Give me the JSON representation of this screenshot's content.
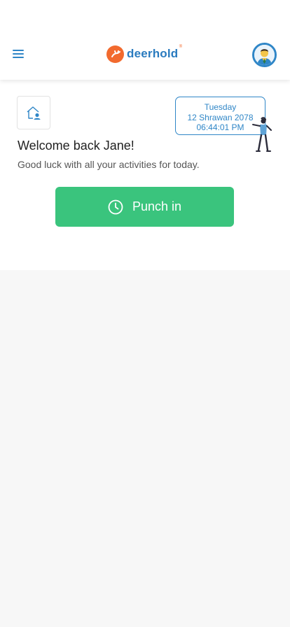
{
  "header": {
    "brand": "deerhold",
    "brand_mark": "®",
    "menu_icon": "hamburger-menu-icon",
    "avatar_icon": "user-avatar-icon"
  },
  "dashboard": {
    "home_icon": "home-user-icon",
    "date": {
      "weekday": "Tuesday",
      "nepali_date": "12 Shrawan 2078",
      "time": "06:44:01 PM"
    },
    "welcome": "Welcome back Jane!",
    "subtitle": "Good luck with all your activities for today.",
    "punch_label": "Punch in",
    "punch_icon": "clock-icon"
  },
  "colors": {
    "accent_blue": "#2f86c7",
    "brand_orange": "#f26a2e",
    "punch_green": "#3ac47d",
    "background": "#f7f7f7"
  }
}
